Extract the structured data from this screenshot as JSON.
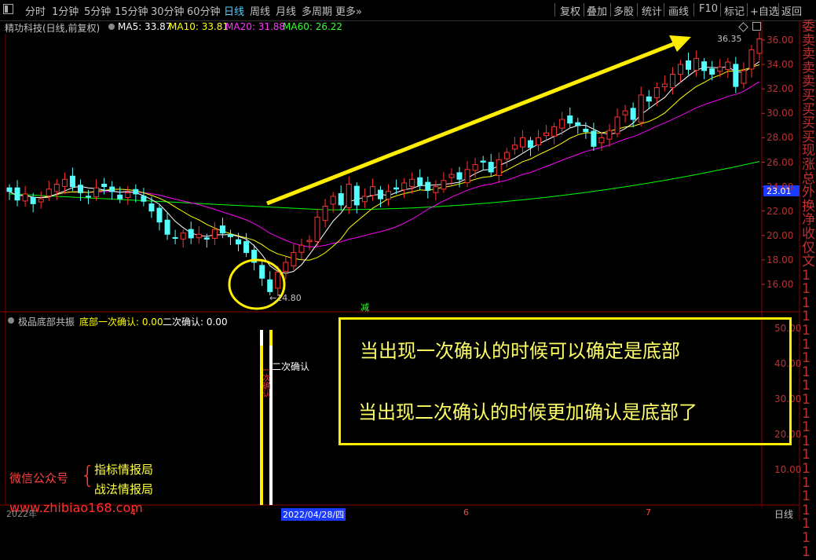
{
  "toolbar": {
    "periods": [
      "分时",
      "1分钟",
      "5分钟",
      "15分钟",
      "30分钟",
      "60分钟",
      "日线",
      "周线",
      "月线",
      "多周期",
      "更多»"
    ],
    "active_period": "日线",
    "right_buttons": [
      "复权",
      "叠加",
      "多股",
      "统计",
      "画线",
      "F10",
      "标记",
      "+自选",
      "返回"
    ]
  },
  "main_chart": {
    "stock_title": "精功科技(日线,前复权)",
    "ma5_label": "MA5: 33.87",
    "ma10_label": "MA10: 33.81",
    "ma20_label": "MA20: 31.88",
    "ma60_label": "MA60: 26.22",
    "high_label": "36.35",
    "low_label": "←14.80",
    "current_price": "23.01",
    "marker_text": "减",
    "y_ticks": [
      "36.00",
      "34.00",
      "32.00",
      "30.00",
      "28.00",
      "26.00",
      "24.00",
      "22.00",
      "20.00",
      "18.00",
      "16.00"
    ],
    "colors": {
      "ma5": "#ffffff",
      "ma10": "#ffff00",
      "ma20": "#ff00ff",
      "ma60": "#00ff00",
      "up": "#ff3232",
      "down": "#54ffff"
    }
  },
  "indicator": {
    "name": "极品底部共振",
    "first_label": "底部一次确认: 0.00",
    "second_label": "二次确认: 0.00",
    "annot_second": "二次确认",
    "annot_first_vertical": "一次确认",
    "y_ticks": [
      "50.00",
      "40.00",
      "30.00",
      "20.00",
      "10.00"
    ]
  },
  "annotation": {
    "line1": "当出现一次确认的时候可以确定是底部",
    "line2": "当出现二次确认的时候更加确认是底部了"
  },
  "watermark": {
    "left": "微信公众号",
    "brace": "{",
    "right1": "指标情报局",
    "right2": "战法情报局",
    "url": "www.zhibiao168.com"
  },
  "bottom_axis": {
    "year": "2022年",
    "m4": "4",
    "date_box": "2022/04/28/四",
    "m6": "6",
    "m7": "7",
    "period_tag": "日线"
  },
  "side_panel_chars": [
    "委",
    "卖",
    "卖",
    "卖",
    "卖",
    "买",
    "买",
    "买",
    "买",
    "现",
    "涨",
    "总",
    "外",
    "换",
    "净",
    "收",
    "仅",
    "文",
    "1",
    "1",
    "1",
    "1",
    "1",
    "1",
    "1",
    "1",
    "1",
    "1",
    "1",
    "1",
    "1",
    "1",
    "1",
    "1",
    "1",
    "1",
    "1",
    "1",
    "1"
  ]
}
